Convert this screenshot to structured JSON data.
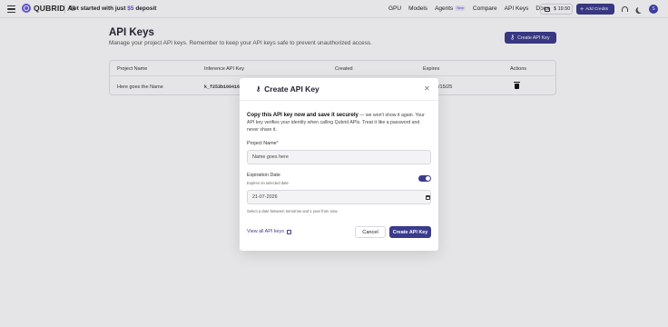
{
  "nav": {
    "brand": "QUBRID",
    "brand_suffix": "AI",
    "promo_prefix": "Get started with just ",
    "promo_amount": "$5",
    "promo_suffix": " deposit",
    "links": [
      {
        "label": "GPU"
      },
      {
        "label": "Models"
      },
      {
        "label": "Agents",
        "badge": "New"
      },
      {
        "label": "Compare"
      },
      {
        "label": "API Keys"
      },
      {
        "label": "Docs"
      }
    ],
    "balance": "$ 19.50",
    "add_credits": "Add Credits",
    "avatar_initial": "S"
  },
  "page": {
    "title": "API Keys",
    "subtitle": "Manage your project API keys. Remember to keep your API keys safe to prevent unauthorized access.",
    "create_button": "Create API Key"
  },
  "table": {
    "headers": [
      "Project Name",
      "Inference API Key",
      "Created",
      "Expires",
      "Actions"
    ],
    "rows": [
      {
        "project": "Here goes the Name",
        "key": "k_f253b100416",
        "created": "",
        "expires": "/15/25"
      }
    ]
  },
  "modal": {
    "title": "Create API Key",
    "info_bold": "Copy this API key now and save it securely",
    "info_rest": " — we won't show it again. Your API key verifies your identity when calling Qubrid APIs. Treat it like a password and never share it.",
    "project_label": "Project Name",
    "project_required": "*",
    "project_placeholder": "Name goes here",
    "expiration_label": "Expiration Date",
    "expiration_hint": "Expires on selected date",
    "expiration_enabled": true,
    "date_value": "21-07-2026",
    "date_hint": "Select a date between tomorrow and 1 year from now.",
    "view_link": "View all API keys",
    "cancel": "Cancel",
    "create": "Create API Key"
  },
  "colors": {
    "accent": "#3b3a8c",
    "brand": "#6a5be0"
  }
}
